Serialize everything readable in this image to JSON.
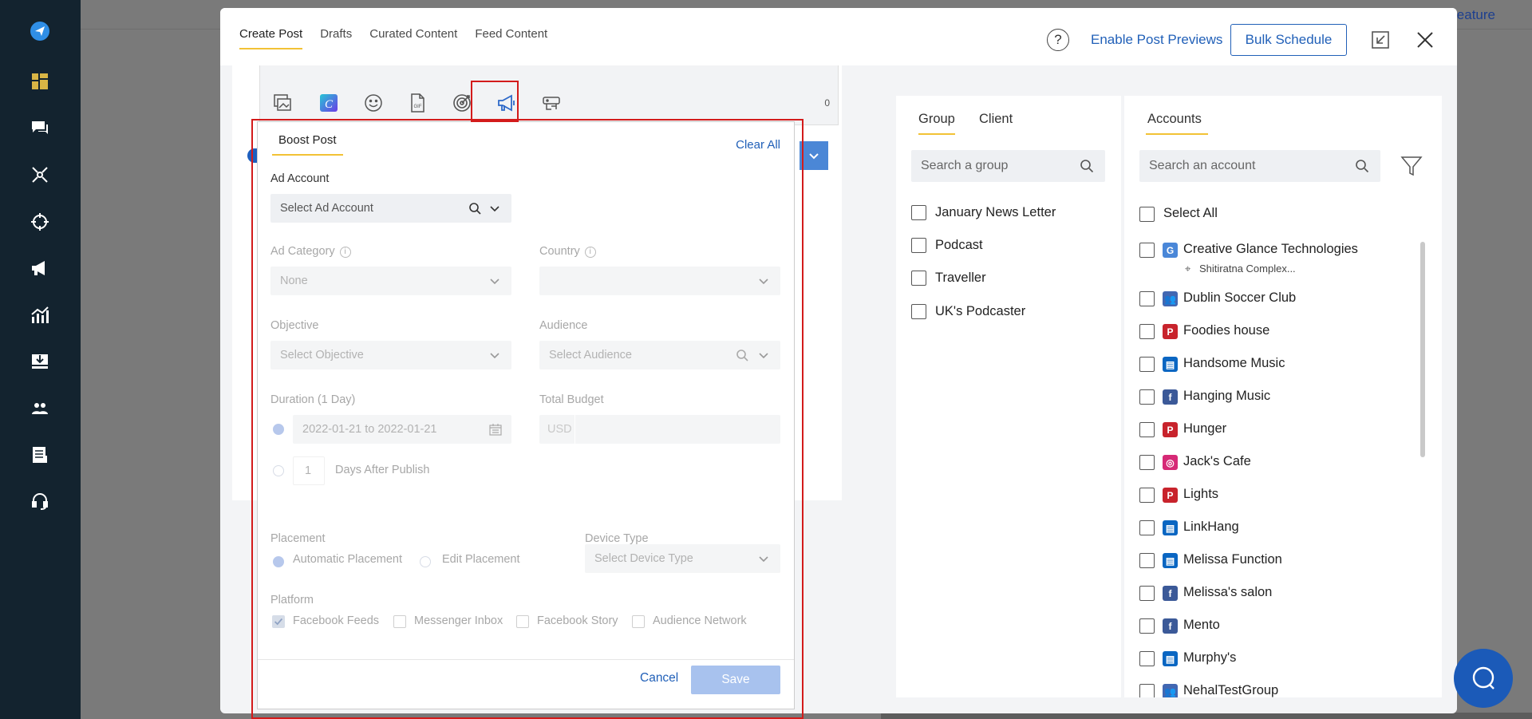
{
  "app_nav": {
    "items": [
      "send-icon",
      "dashboard-icon",
      "messages-icon",
      "network-icon",
      "target-icon",
      "megaphone-icon",
      "analytics-icon",
      "inbox-icon",
      "team-icon",
      "reports-icon",
      "support-icon"
    ]
  },
  "background": {
    "link_fragment": "eature"
  },
  "header": {
    "tabs": [
      "Create Post",
      "Drafts",
      "Curated Content",
      "Feed Content"
    ],
    "help_symbol": "?",
    "enable_previews": "Enable Post Previews",
    "bulk_schedule": "Bulk Schedule"
  },
  "toolbar": {
    "icons": [
      "media-library-icon",
      "canva-icon",
      "emoji-icon",
      "gif-icon",
      "target-icon",
      "boost-post-icon",
      "bot-icon"
    ],
    "canva_letter": "C",
    "char_count": "0"
  },
  "boost": {
    "tab": "Boost Post",
    "clear_all": "Clear All",
    "ad_account_label": "Ad Account",
    "ad_account_placeholder": "Select Ad Account",
    "ad_category_label": "Ad Category",
    "ad_category_value": "None",
    "country_label": "Country",
    "objective_label": "Objective",
    "objective_placeholder": "Select Objective",
    "audience_label": "Audience",
    "audience_placeholder": "Select Audience",
    "duration_label": "Duration (1 Day)",
    "date_range": "2022-01-21 to 2022-01-21",
    "days_value": "1",
    "days_after": "Days After Publish",
    "budget_label": "Total Budget",
    "currency": "USD",
    "placement_label": "Placement",
    "automatic_placement": "Automatic Placement",
    "edit_placement": "Edit Placement",
    "device_type_label": "Device Type",
    "device_type_placeholder": "Select Device Type",
    "platform_label": "Platform",
    "platforms": [
      {
        "label": "Facebook Feeds",
        "checked": true
      },
      {
        "label": "Messenger Inbox",
        "checked": false
      },
      {
        "label": "Facebook Story",
        "checked": false
      },
      {
        "label": "Audience Network",
        "checked": false
      }
    ],
    "cancel": "Cancel",
    "save": "Save"
  },
  "groups": {
    "tabs": [
      "Group",
      "Client"
    ],
    "search_placeholder": "Search a group",
    "items": [
      "January News Letter",
      "Podcast",
      "Traveller",
      "UK's Podcaster"
    ]
  },
  "accounts": {
    "tab": "Accounts",
    "search_placeholder": "Search an account",
    "select_all": "Select All",
    "items": [
      {
        "name": "Creative Glance Technologies",
        "network": "google-business",
        "sub": "Shitiratna Complex..."
      },
      {
        "name": "Dublin Soccer Club",
        "network": "facebook-group"
      },
      {
        "name": "Foodies house",
        "network": "pinterest"
      },
      {
        "name": "Handsome Music",
        "network": "linkedin-page"
      },
      {
        "name": "Hanging Music",
        "network": "facebook"
      },
      {
        "name": "Hunger",
        "network": "pinterest"
      },
      {
        "name": "Jack's Cafe",
        "network": "instagram"
      },
      {
        "name": "Lights",
        "network": "pinterest"
      },
      {
        "name": "LinkHang",
        "network": "linkedin-page"
      },
      {
        "name": "Melissa Function",
        "network": "linkedin-page"
      },
      {
        "name": "Melissa's salon",
        "network": "facebook"
      },
      {
        "name": "Mento",
        "network": "facebook"
      },
      {
        "name": "Murphy's",
        "network": "linkedin-page"
      },
      {
        "name": "NehalTestGroup",
        "network": "facebook-group"
      }
    ]
  },
  "colors": {
    "nav_bg": "#13232f",
    "accent_yellow": "#f2c235",
    "link_blue": "#2160b8",
    "annotation_red": "#d31b1b",
    "facebook": "#3b5998",
    "pinterest": "#c8232c",
    "linkedin": "#0a66c2"
  }
}
